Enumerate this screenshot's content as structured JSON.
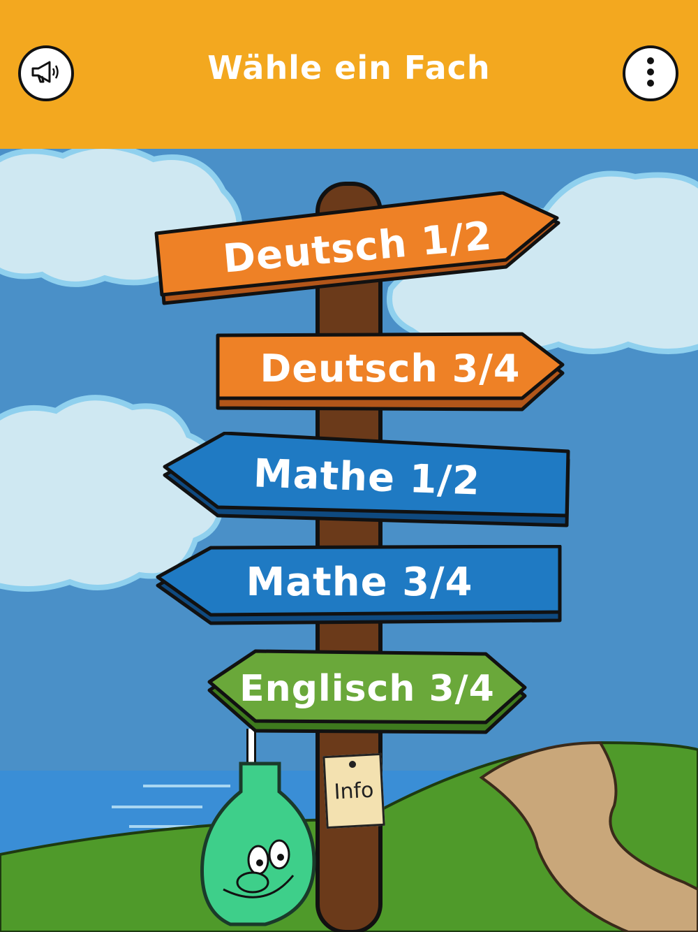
{
  "header": {
    "title": "Wähle ein Fach",
    "left_icon": "megaphone-icon",
    "right_icon": "more-vertical-icon"
  },
  "signs": [
    {
      "label": "Deutsch 1/2",
      "color": "#ee8126"
    },
    {
      "label": "Deutsch 3/4",
      "color": "#ee8126"
    },
    {
      "label": "Mathe 1/2",
      "color": "#1f7ac3"
    },
    {
      "label": "Mathe 3/4",
      "color": "#1f7ac3"
    },
    {
      "label": "Englisch 3/4",
      "color": "#6aa83a"
    }
  ],
  "info": {
    "label": "Info"
  },
  "colors": {
    "header": "#f3a81f",
    "sky": "#4a90c8",
    "post": "#6b3a1a",
    "grass": "#4f9a2a",
    "sea": "#3a8ed6",
    "path": "#c9a77a"
  }
}
